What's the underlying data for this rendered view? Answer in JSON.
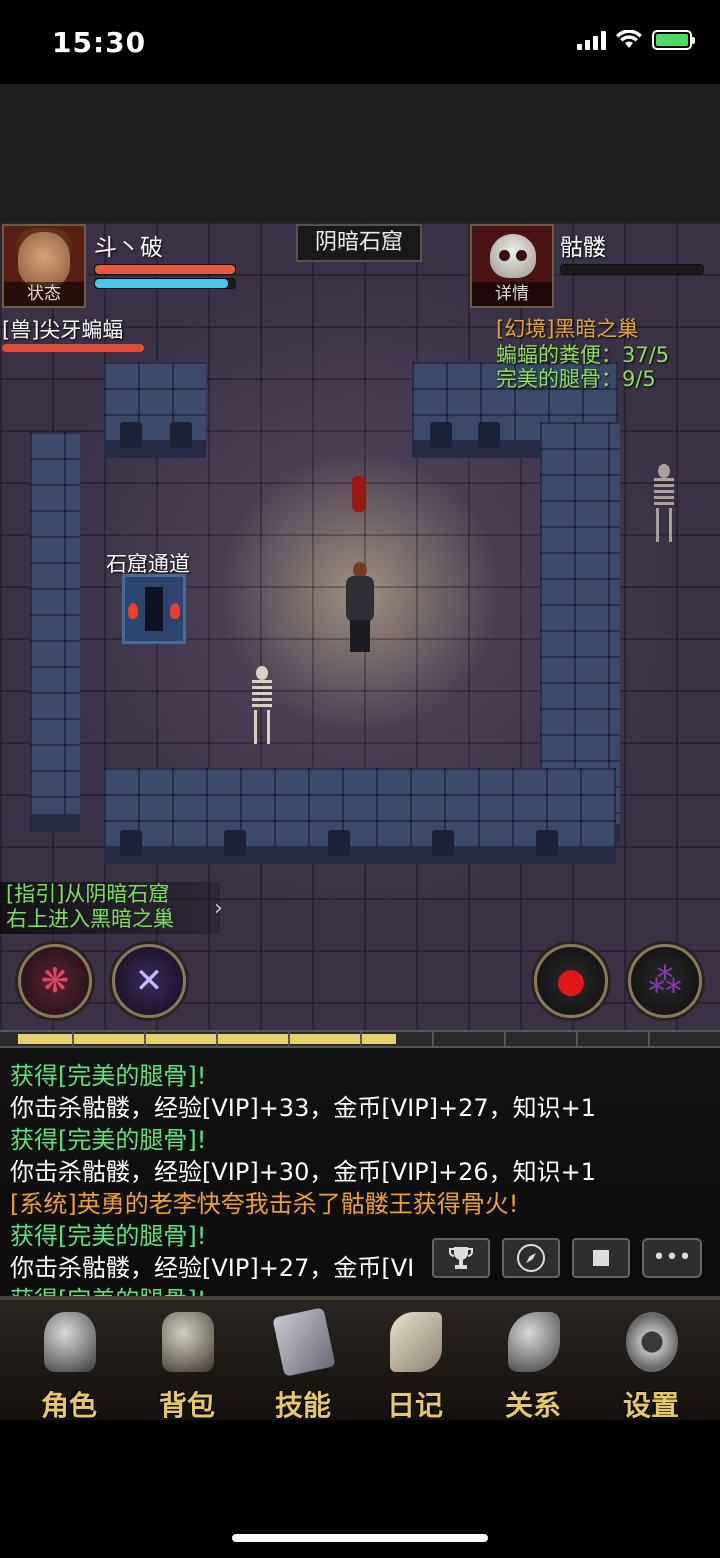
{
  "status_bar": {
    "time": "15:30"
  },
  "player": {
    "name": "斗丶破",
    "portrait_caption": "状态",
    "hp_fraction": 1.0,
    "mp_fraction": 0.95
  },
  "location": "阴暗石窟",
  "enemy": {
    "name": "骷髅",
    "portrait_caption": "详情",
    "hp_fraction": 0.0
  },
  "target": {
    "label": "[兽]尖牙蝙蝠",
    "hp_fraction": 1.0
  },
  "quest": {
    "title": "[幻境]黑暗之巢",
    "items": [
      {
        "text": "蝙蝠的粪便：37/5"
      },
      {
        "text": "完美的腿骨：9/5"
      }
    ]
  },
  "map": {
    "portal_label": "石窟通道"
  },
  "guide": {
    "line1": "[指引]从阴暗石窟",
    "line2": "右上进入黑暗之巢"
  },
  "exp_progress": 0.54,
  "chat": [
    {
      "text": "获得[完美的腿骨]!",
      "color": "#5ee07a"
    },
    {
      "text": "你击杀骷髅，经验[VIP]+33，金币[VIP]+27，知识+1",
      "color": "#ffffff"
    },
    {
      "text": "获得[完美的腿骨]!",
      "color": "#5ee07a"
    },
    {
      "text": "你击杀骷髅，经验[VIP]+30，金币[VIP]+26，知识+1",
      "color": "#ffffff"
    },
    {
      "text": "[系统]英勇的老李快夸我击杀了骷髅王获得骨火!",
      "color": "#f0a030"
    },
    {
      "text": "获得[完美的腿骨]!",
      "color": "#5ee07a"
    },
    {
      "text": "你击杀骷髅，经验[VIP]+27，金币[VI",
      "color": "#ffffff"
    },
    {
      "text": "获得[完美的腿骨]!",
      "color": "#5ee07a"
    }
  ],
  "chat_buttons": {
    "trophy": "trophy-icon",
    "compass": "compass-icon",
    "stop": "stop-icon",
    "more": "more-icon",
    "more_glyph": "•••"
  },
  "nav": [
    {
      "label": "角色",
      "icon": "helmet-icon"
    },
    {
      "label": "背包",
      "icon": "backpack-icon"
    },
    {
      "label": "技能",
      "icon": "skillbook-icon"
    },
    {
      "label": "日记",
      "icon": "scroll-icon"
    },
    {
      "label": "关系",
      "icon": "handshake-icon"
    },
    {
      "label": "设置",
      "icon": "gear-icon"
    }
  ],
  "colors": {
    "quest_title": "#e8a830",
    "quest_item": "#8ee05a",
    "nav_label": "#e7c768",
    "hp": "#e85a40",
    "mp": "#4cc4ec"
  }
}
